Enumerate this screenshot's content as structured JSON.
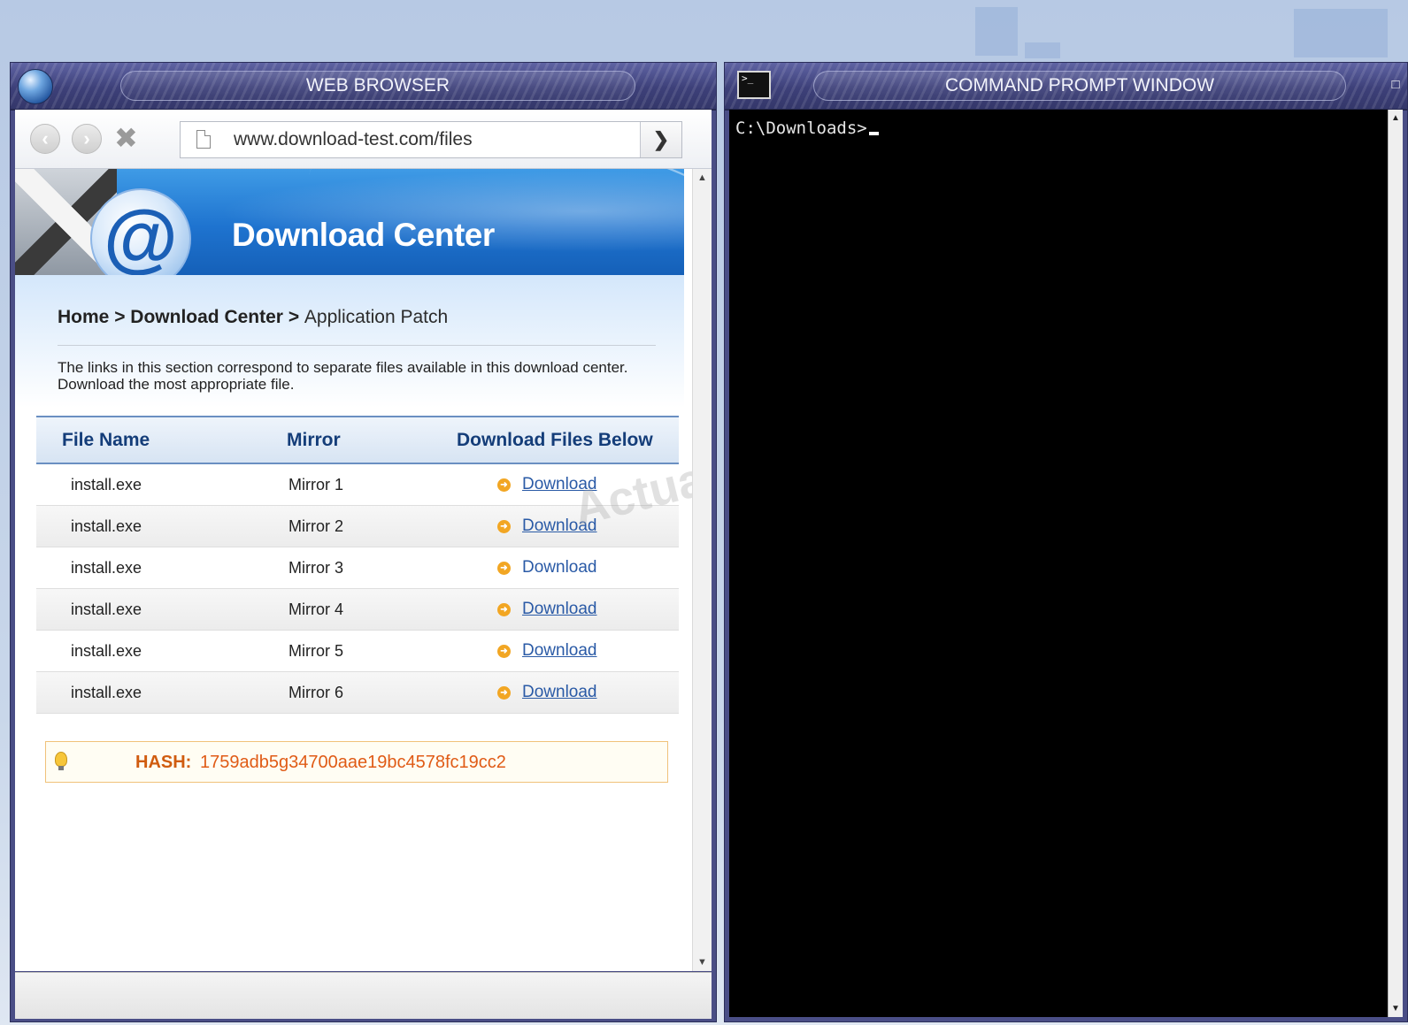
{
  "browser": {
    "title": "WEB BROWSER",
    "url": "www.download-test.com/files",
    "go_icon": "arrow-right",
    "banner_title": "Download Center",
    "breadcrumb": {
      "home": "Home",
      "sep1": " > ",
      "section": "Download Center",
      "sep2": " > ",
      "current": "Application Patch"
    },
    "intro": "The links in this section correspond to separate files available in this download center. Download the most appropriate file.",
    "table": {
      "headers": [
        "File Name",
        "Mirror",
        "Download Files Below"
      ],
      "rows": [
        {
          "file": "install.exe",
          "mirror": "Mirror 1",
          "link": "Download"
        },
        {
          "file": "install.exe",
          "mirror": "Mirror 2",
          "link": "Download"
        },
        {
          "file": "install.exe",
          "mirror": "Mirror 3",
          "link": "Download"
        },
        {
          "file": "install.exe",
          "mirror": "Mirror 4",
          "link": "Download"
        },
        {
          "file": "install.exe",
          "mirror": "Mirror 5",
          "link": "Download"
        },
        {
          "file": "install.exe",
          "mirror": "Mirror 6",
          "link": "Download"
        }
      ]
    },
    "watermark": "Actual",
    "hash": {
      "label": "HASH:",
      "value": "1759adb5g34700aae19bc4578fc19cc2"
    }
  },
  "cmd": {
    "title": "COMMAND PROMPT WINDOW",
    "prompt": "C:\\Downloads>"
  },
  "colors": {
    "frame": "#4a4e86",
    "link": "#2a5aa6",
    "header_text": "#143d79",
    "hash_text": "#e05b16"
  }
}
